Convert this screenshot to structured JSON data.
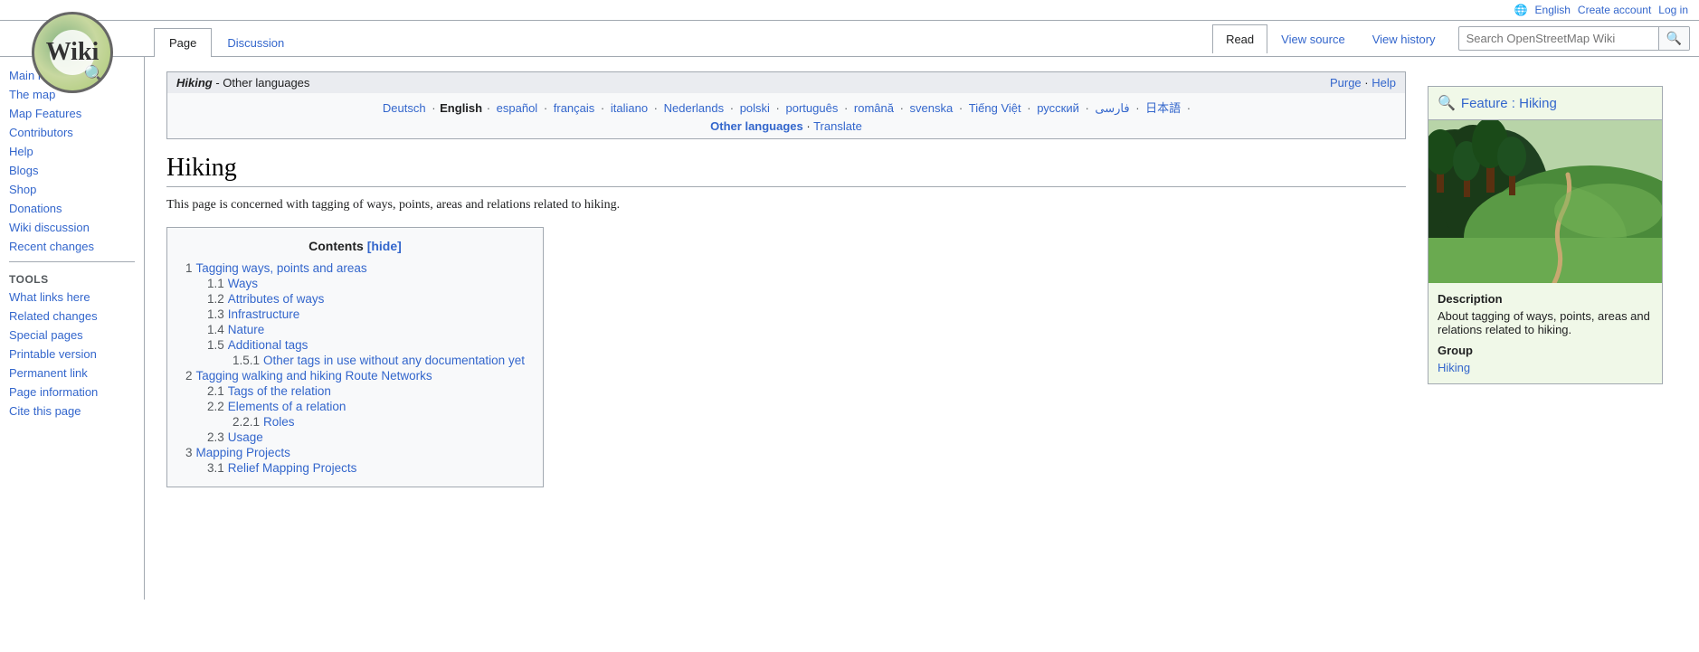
{
  "topbar": {
    "lang_icon": "🌐",
    "lang": "English",
    "create_account": "Create account",
    "log_in": "Log in"
  },
  "header": {
    "tabs": [
      {
        "id": "page",
        "label": "Page",
        "active": true
      },
      {
        "id": "discussion",
        "label": "Discussion",
        "active": false
      }
    ],
    "actions": [
      {
        "id": "read",
        "label": "Read",
        "active": true
      },
      {
        "id": "view-source",
        "label": "View source",
        "active": false
      },
      {
        "id": "view-history",
        "label": "View history",
        "active": false
      }
    ],
    "search_placeholder": "Search OpenStreetMap Wiki",
    "wiki_letter": "Wiki"
  },
  "sidebar": {
    "nav_items": [
      {
        "id": "main-page",
        "label": "Main Page"
      },
      {
        "id": "the-map",
        "label": "The map"
      },
      {
        "id": "map-features",
        "label": "Map Features"
      },
      {
        "id": "contributors",
        "label": "Contributors"
      },
      {
        "id": "help",
        "label": "Help"
      },
      {
        "id": "blogs",
        "label": "Blogs"
      },
      {
        "id": "shop",
        "label": "Shop"
      },
      {
        "id": "donations",
        "label": "Donations"
      },
      {
        "id": "wiki-discussion",
        "label": "Wiki discussion"
      },
      {
        "id": "recent-changes",
        "label": "Recent changes"
      }
    ],
    "tools_title": "Tools",
    "tool_items": [
      {
        "id": "what-links-here",
        "label": "What links here"
      },
      {
        "id": "related-changes",
        "label": "Related changes"
      },
      {
        "id": "special-pages",
        "label": "Special pages"
      },
      {
        "id": "printable-version",
        "label": "Printable version"
      },
      {
        "id": "permanent-link",
        "label": "Permanent link"
      },
      {
        "id": "page-information",
        "label": "Page information"
      },
      {
        "id": "cite-this-page",
        "label": "Cite this page"
      }
    ]
  },
  "lang_box": {
    "title_italic": "Hiking",
    "title_rest": " - Other languages",
    "purge": "Purge",
    "help": "Help",
    "languages": [
      {
        "label": "Deutsch",
        "active": false
      },
      {
        "label": "English",
        "active": true
      },
      {
        "label": "español",
        "active": false
      },
      {
        "label": "français",
        "active": false
      },
      {
        "label": "italiano",
        "active": false
      },
      {
        "label": "Nederlands",
        "active": false
      },
      {
        "label": "polski",
        "active": false
      },
      {
        "label": "português",
        "active": false
      },
      {
        "label": "română",
        "active": false
      },
      {
        "label": "svenska",
        "active": false
      },
      {
        "label": "Tiếng Việt",
        "active": false
      },
      {
        "label": "русский",
        "active": false
      },
      {
        "label": "فارسی",
        "active": false
      },
      {
        "label": "日本語",
        "active": false
      }
    ],
    "other_languages": "Other languages",
    "translate": "Translate"
  },
  "page": {
    "title": "Hiking",
    "intro": "This page is concerned with tagging of ways, points, areas and relations related to hiking."
  },
  "toc": {
    "header": "Contents",
    "hide_label": "[hide]",
    "items": [
      {
        "num": "1",
        "label": "Tagging ways, points and areas",
        "level": 1
      },
      {
        "num": "1.1",
        "label": "Ways",
        "level": 2
      },
      {
        "num": "1.2",
        "label": "Attributes of ways",
        "level": 2
      },
      {
        "num": "1.3",
        "label": "Infrastructure",
        "level": 2
      },
      {
        "num": "1.4",
        "label": "Nature",
        "level": 2
      },
      {
        "num": "1.5",
        "label": "Additional tags",
        "level": 2
      },
      {
        "num": "1.5.1",
        "label": "Other tags in use without any documentation yet",
        "level": 3
      },
      {
        "num": "2",
        "label": "Tagging walking and hiking Route Networks",
        "level": 1
      },
      {
        "num": "2.1",
        "label": "Tags of the relation",
        "level": 2
      },
      {
        "num": "2.2",
        "label": "Elements of a relation",
        "level": 2
      },
      {
        "num": "2.2.1",
        "label": "Roles",
        "level": 3
      },
      {
        "num": "2.3",
        "label": "Usage",
        "level": 2
      },
      {
        "num": "3",
        "label": "Mapping Projects",
        "level": 1
      },
      {
        "num": "3.1",
        "label": "Relief Mapping Projects",
        "level": 2
      }
    ]
  },
  "feature_box": {
    "icon": "🔍",
    "title": "Feature : Hiking",
    "description_title": "Description",
    "description_text": "About tagging of ways, points, areas and relations related to hiking.",
    "group_title": "Group",
    "group_link": "Hiking"
  }
}
